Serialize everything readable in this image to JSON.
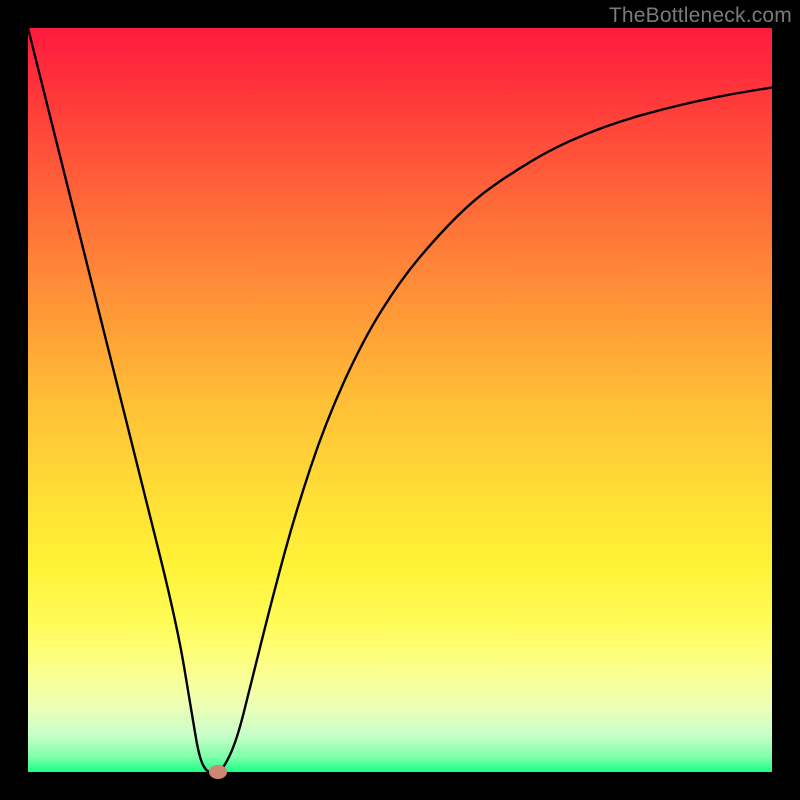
{
  "watermark": "TheBottleneck.com",
  "chart_data": {
    "type": "line",
    "title": "",
    "xlabel": "",
    "ylabel": "",
    "xlim": [
      0,
      100
    ],
    "ylim": [
      0,
      100
    ],
    "series": [
      {
        "name": "curve",
        "x": [
          0,
          5,
          10,
          15,
          20,
          22,
          23,
          24,
          25,
          26,
          28,
          30,
          33,
          36,
          40,
          45,
          50,
          55,
          60,
          65,
          70,
          75,
          80,
          85,
          90,
          95,
          100
        ],
        "y": [
          100,
          80,
          60,
          40,
          20,
          8,
          2,
          0,
          0,
          0,
          4,
          12,
          24,
          35,
          47,
          58,
          66,
          72,
          77,
          80.5,
          83.5,
          85.8,
          87.6,
          89,
          90.2,
          91.2,
          92
        ]
      }
    ],
    "marker": {
      "x": 25.5,
      "y": 0,
      "color": "#cf8670"
    },
    "background_gradient": {
      "top": "#ff1a3f",
      "mid": "#ffdc36",
      "bottom": "#18ff84"
    }
  }
}
